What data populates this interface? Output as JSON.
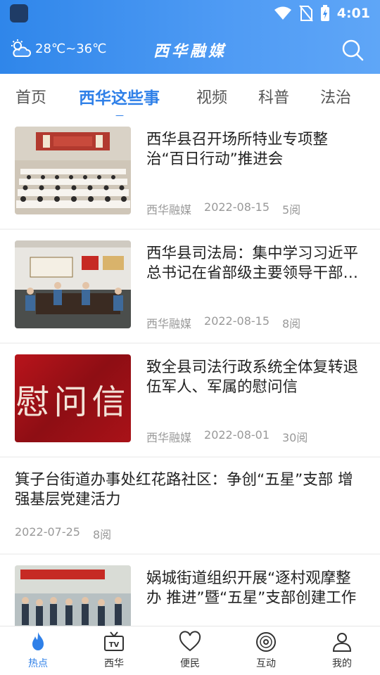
{
  "status": {
    "time": "4:01"
  },
  "header": {
    "weather_temp": "28℃~36℃",
    "brand": "西华融媒"
  },
  "tabs": [
    {
      "label": "首页",
      "active": false
    },
    {
      "label": "西华这些事",
      "active": true
    },
    {
      "label": "视频",
      "active": false
    },
    {
      "label": "科普",
      "active": false
    },
    {
      "label": "法治",
      "active": false
    }
  ],
  "articles": [
    {
      "title": "西华县召开场所特业专项整治“百日行动”推进会",
      "source": "西华融媒",
      "date": "2022-08-15",
      "views": "5阅",
      "thumb": "meeting-hall"
    },
    {
      "title": "西华县司法局：集中学习习近平总书记在省部级主要领导干部专题研讨班上重要讲话精神",
      "source": "西华融媒",
      "date": "2022-08-15",
      "views": "8阅",
      "thumb": "conference-room"
    },
    {
      "title": "致全县司法行政系统全体复转退伍军人、军属的慰问信",
      "source": "西华融媒",
      "date": "2022-08-01",
      "views": "30阅",
      "thumb": "red-letter",
      "thumb_text": "慰问信"
    },
    {
      "title": "箕子台街道办事处红花路社区：争创“五星”支部 增强基层党建活力",
      "date": "2022-07-25",
      "views": "8阅"
    },
    {
      "title": "娲城街道组织开展“逐村观摩整办 推进”暨“五星”支部创建工作",
      "thumb": "outdoor-crowd"
    }
  ],
  "nav": [
    {
      "label": "热点",
      "icon": "flame-icon",
      "active": true
    },
    {
      "label": "西华",
      "icon": "tv-icon",
      "active": false
    },
    {
      "label": "便民",
      "icon": "heart-icon",
      "active": false
    },
    {
      "label": "互动",
      "icon": "disc-icon",
      "active": false
    },
    {
      "label": "我的",
      "icon": "user-icon",
      "active": false
    }
  ],
  "colors": {
    "accent": "#2f80e8",
    "header_start": "#2f86ea",
    "header_end": "#5fa6f7"
  }
}
